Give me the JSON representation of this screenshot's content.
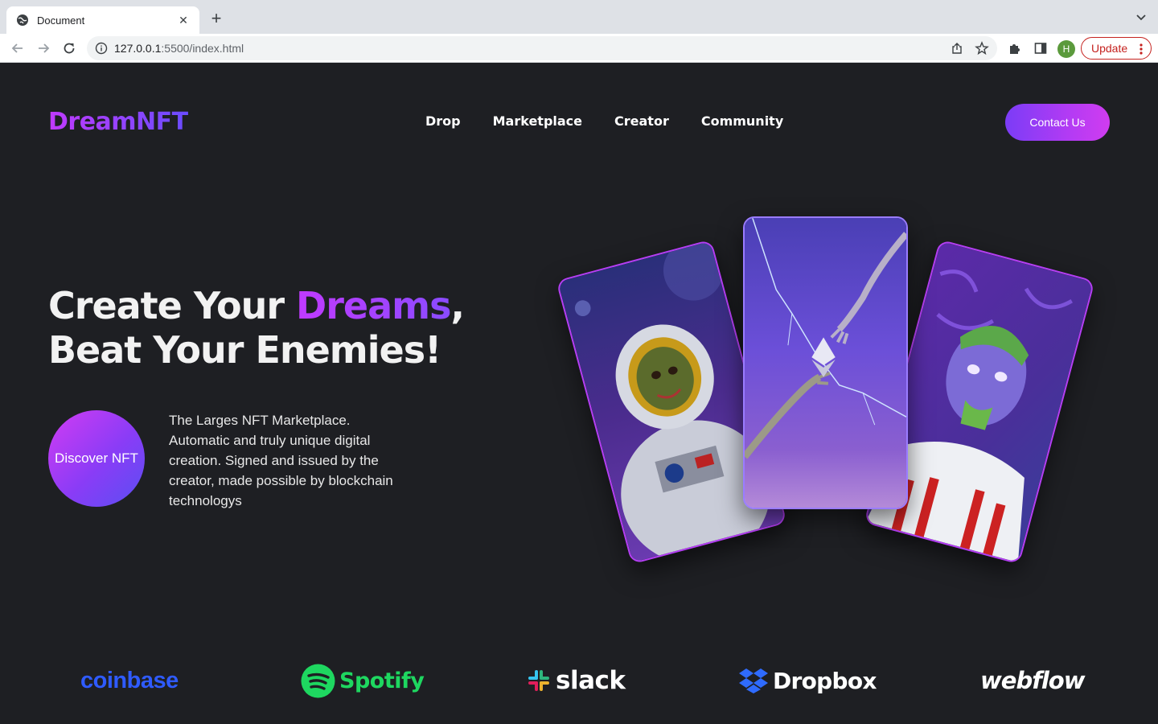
{
  "browser": {
    "tab_title": "Document",
    "url_host": "127.0.0.1",
    "url_path": ":5500/index.html",
    "profile_initial": "H",
    "update_label": "Update"
  },
  "header": {
    "logo": "DreamNFT",
    "nav": [
      "Drop",
      "Marketplace",
      "Creator",
      "Community"
    ],
    "contact_label": "Contact Us"
  },
  "hero": {
    "title_part1": "Create Your ",
    "title_accent": "Dreams",
    "title_part2": ",",
    "title_line2": "Beat Your Enemies!",
    "discover_label": "Discover NFT",
    "description": "The Larges NFT Marketplace. Automatic and truly unique digital creation. Signed and issued by the creator, made possible by blockchain technologys"
  },
  "cards": [
    {
      "name": "zombie-astronaut",
      "accent": "#b53ef5"
    },
    {
      "name": "ethereum-hands",
      "accent": "#9a7cff"
    },
    {
      "name": "zombie-basketball",
      "accent": "#b53ef5"
    }
  ],
  "brands": [
    {
      "name": "coinbase",
      "label": "coinbase",
      "color": "#2f5bff"
    },
    {
      "name": "spotify",
      "label": "Spotify",
      "color": "#1ed760"
    },
    {
      "name": "slack",
      "label": "slack",
      "color": "#ffffff"
    },
    {
      "name": "dropbox",
      "label": "Dropbox",
      "color": "#ffffff"
    },
    {
      "name": "webflow",
      "label": "webflow",
      "color": "#ffffff"
    }
  ],
  "colors": {
    "background": "#1e1f23",
    "accent_purple": "#c13aff",
    "accent_blue": "#6a4cff"
  }
}
